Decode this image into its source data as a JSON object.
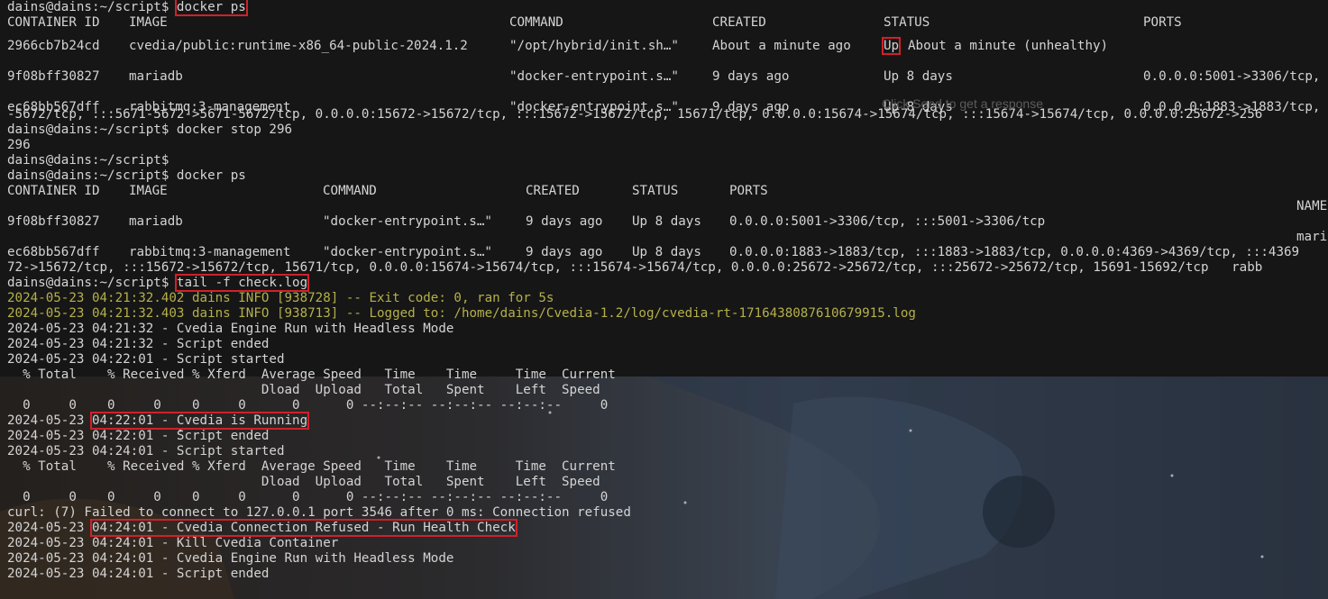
{
  "prompt_user": "dains@dains:~/script$",
  "session1": {
    "command": "docker ps",
    "headers": {
      "id": "CONTAINER ID",
      "image": "IMAGE",
      "command": "COMMAND",
      "created": "CREATED",
      "status": "STATUS",
      "ports": "PORTS"
    },
    "rows": [
      {
        "id": "2966cb7b24cd",
        "image": "cvedia/public:runtime-x86_64-public-2024.1.2",
        "command": "\"/opt/hybrid/init.sh…\"",
        "created": "About a minute ago",
        "status_up": "Up",
        "status_rest": "About a minute (unhealthy)",
        "ports": ""
      },
      {
        "id": "9f08bff30827",
        "image": "mariadb",
        "command": "\"docker-entrypoint.s…\"",
        "created": "9 days ago",
        "status_up": "Up 8 days",
        "status_rest": "",
        "ports": "0.0.0.0:5001->3306/tcp,"
      },
      {
        "id": "ec68bb567dff",
        "image": "rabbitmq:3-management",
        "command": "\"docker-entrypoint.s…\"",
        "created": "9 days ago",
        "status_up": "Up 8 days",
        "status_rest": "",
        "ports": "0.0.0.0:1883->1883/tcp,"
      }
    ],
    "wrap": "-5672/tcp, :::5671-5672->5671-5672/tcp, 0.0.0.0:15672->15672/tcp, :::15672->15672/tcp, 15671/tcp, 0.0.0.0:15674->15674/tcp, :::15674->15674/tcp, 0.0.0.0:25672->256"
  },
  "overlay_hint": "Click Send to get a response",
  "stop": {
    "command": "docker stop 296",
    "output": "296"
  },
  "session2": {
    "command": "docker ps",
    "headers": {
      "id": "CONTAINER ID",
      "image": "IMAGE",
      "command": "COMMAND",
      "created": "CREATED",
      "status": "STATUS",
      "ports": "PORTS",
      "names": "NAME"
    },
    "rows": [
      {
        "id": "9f08bff30827",
        "image": "mariadb",
        "command": "\"docker-entrypoint.s…\"",
        "created": "9 days ago",
        "status": "Up 8 days",
        "ports": "0.0.0.0:5001->3306/tcp, :::5001->3306/tcp",
        "name": "mari"
      },
      {
        "id": "ec68bb567dff",
        "image": "rabbitmq:3-management",
        "command": "\"docker-entrypoint.s…\"",
        "created": "9 days ago",
        "status": "Up 8 days",
        "ports": "0.0.0.0:1883->1883/tcp, :::1883->1883/tcp, 0.0.0.0:4369->4369/tcp, :::4369",
        "name": ""
      }
    ],
    "wrap": "72->15672/tcp, :::15672->15672/tcp, 15671/tcp, 0.0.0.0:15674->15674/tcp, :::15674->15674/tcp, 0.0.0.0:25672->25672/tcp, :::25672->25672/tcp, 15691-15692/tcp   rabb"
  },
  "tail": {
    "command": "tail -f check.log",
    "log_info": [
      "2024-05-23 04:21:32.402 dains INFO [938728] -- Exit code: 0, ran for 5s",
      "2024-05-23 04:21:32.403 dains INFO [938713] -- Logged to: /home/dains/Cvedia-1.2/log/cvedia-rt-1716438087610679915.log"
    ],
    "lines_a": [
      "2024-05-23 04:21:32 - Cvedia Engine Run with Headless Mode",
      "2024-05-23 04:21:32 - Script ended",
      "2024-05-23 04:22:01 - Script started"
    ],
    "curl_h1": "  % Total    % Received % Xferd  Average Speed   Time    Time     Time  Current",
    "curl_h2": "                                 Dload  Upload   Total   Spent    Left  Speed",
    "curl_row": "  0     0    0     0    0     0      0      0 --:--:-- --:--:-- --:--:--     0",
    "running_date": "2024-05-23 ",
    "running_msg": "04:22:01 - Cvedia is Running",
    "lines_b": [
      "2024-05-23 04:22:01 - Script ended",
      "2024-05-23 04:24:01 - Script started"
    ],
    "curl_error": "curl: (7) Failed to connect to 127.0.0.1 port 3546 after 0 ms: Connection refused",
    "refused_date": "2024-05-23 ",
    "refused_msg": "04:24:01 - Cvedia Connection Refused - Run Health Check",
    "lines_c": [
      "2024-05-23 04:24:01 - Kill Cvedia Container",
      "2024-05-23 04:24:01 - Cvedia Engine Run with Headless Mode",
      "2024-05-23 04:24:01 - Script ended"
    ]
  }
}
